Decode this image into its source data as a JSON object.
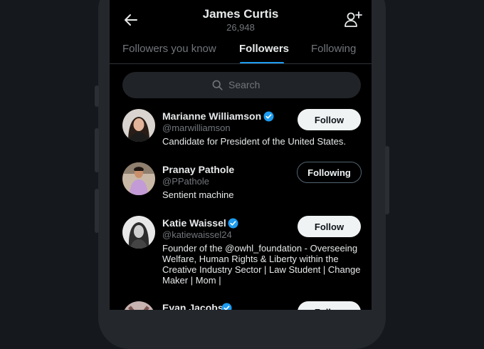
{
  "header": {
    "title": "James Curtis",
    "count": "26,948",
    "back_icon": "back-arrow-icon",
    "add_icon": "add-user-icon"
  },
  "tabs": [
    {
      "label": "Followers you know",
      "active": false
    },
    {
      "label": "Followers",
      "active": true
    },
    {
      "label": "Following",
      "active": false
    }
  ],
  "search": {
    "placeholder": "Search",
    "icon": "search-icon"
  },
  "users": [
    {
      "name": "Marianne Williamson",
      "handle": "@marwilliamson",
      "verified": true,
      "bio": [
        "Candidate for President of the United States."
      ],
      "button": "Follow"
    },
    {
      "name": "Pranay Pathole",
      "handle": "@PPathole",
      "verified": false,
      "bio": [
        "Sentient machine"
      ],
      "button": "Following"
    },
    {
      "name": "Katie Waissel",
      "handle": "@katiewaissel24",
      "verified": true,
      "bio": [
        "Founder of the @owhl_foundation - Overseeing",
        "Welfare, Human Rights & Liberty within the",
        "Creative Industry Sector | Law Student | Change",
        "Maker | Mom |"
      ],
      "button": "Follow"
    },
    {
      "name": "Evan Jacobs",
      "verified": true,
      "button": "Follow"
    }
  ],
  "colors": {
    "background": "#000000",
    "accent": "#1d9bf0",
    "muted_text": "#71767b",
    "follow_button": "#eff3f4"
  }
}
